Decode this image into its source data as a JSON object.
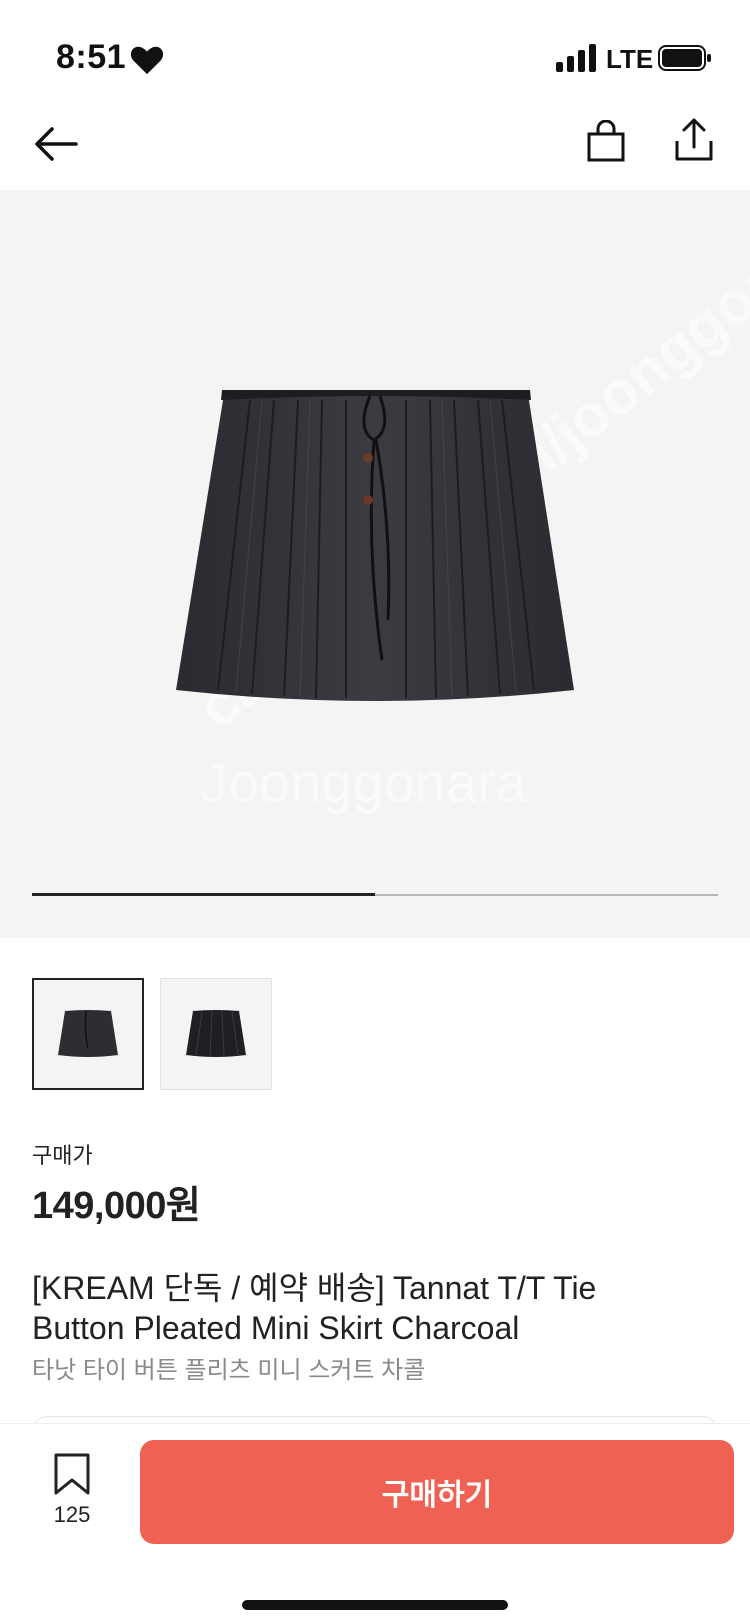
{
  "status_bar": {
    "time": "8:51",
    "network": "LTE"
  },
  "nav": {
    "icons": [
      "back-arrow-icon",
      "shopping-bag-icon",
      "share-icon"
    ]
  },
  "gallery": {
    "image_count": 2,
    "active_index": 0,
    "progress_fraction": 0.5,
    "watermark_texts": [
      "cafe.naver.com/joonggonara",
      "Joonggonara",
      "joonggonara"
    ]
  },
  "price": {
    "label": "구매가",
    "value": "149,000원"
  },
  "product": {
    "title": "[KREAM 단독 / 예약 배송] Tannat T/T Tie Button Pleated Mini Skirt Charcoal",
    "subtitle": "타낫 타이 버튼 플리츠 미니 스커트 차콜"
  },
  "bottom": {
    "wish_count": "125",
    "buy_label": "구매하기"
  },
  "colors": {
    "accent": "#ef6253",
    "hero_bg": "#f4f4f4",
    "text": "#222222",
    "subtext": "#8a8a8a"
  }
}
